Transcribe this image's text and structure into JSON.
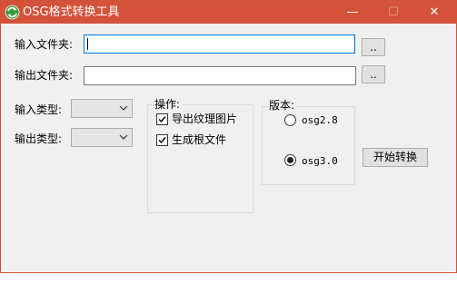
{
  "window": {
    "title": "OSG格式转换工具",
    "minimize_glyph": "—",
    "maximize_glyph": "☐",
    "close_glyph": "✕",
    "accent_color": "#d4523a"
  },
  "input_folder": {
    "label": "输入文件夹:",
    "value": "",
    "browse_label": ".."
  },
  "output_folder": {
    "label": "输出文件夹:",
    "value": "",
    "browse_label": ".."
  },
  "input_type": {
    "label": "输入类型:",
    "selected": ""
  },
  "output_type": {
    "label": "输出类型:",
    "selected": ""
  },
  "operations": {
    "title": "操作:",
    "export_textures": {
      "label": "导出纹理图片",
      "checked": true
    },
    "generate_root": {
      "label": "生成根文件",
      "checked": true
    }
  },
  "version": {
    "title": "版本:",
    "options": [
      {
        "label": "osg2.8",
        "selected": false
      },
      {
        "label": "osg3.0",
        "selected": true
      }
    ]
  },
  "start_button": {
    "label": "开始转换"
  }
}
